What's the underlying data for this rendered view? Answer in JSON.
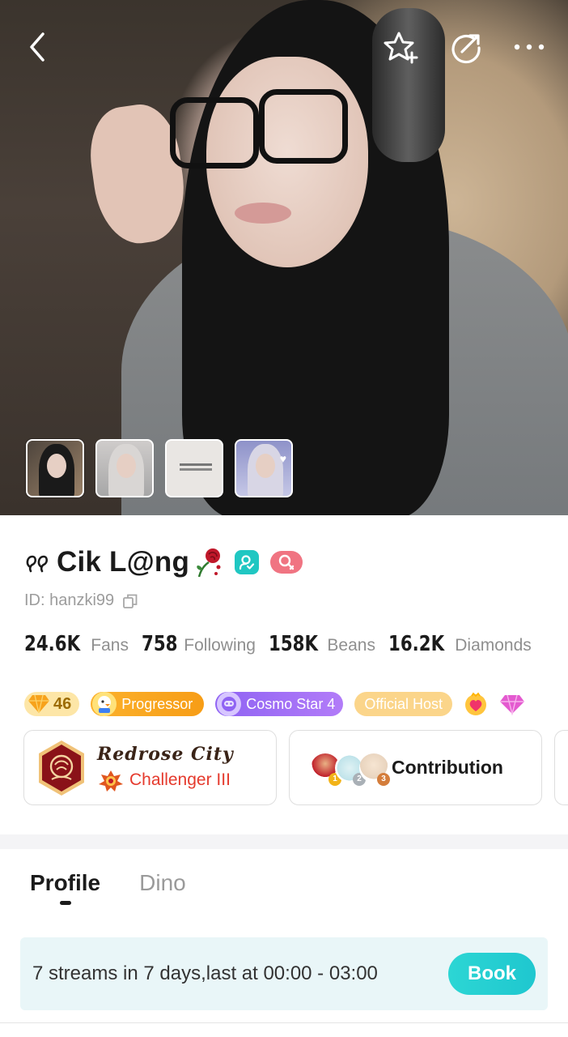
{
  "header": {
    "icons": [
      "back-arrow-icon",
      "star-plus-icon",
      "share-icon",
      "more-icon"
    ]
  },
  "gallery": {
    "thumbnail_count": 4,
    "selected_index": 0
  },
  "profile": {
    "name": "Cik L@ng",
    "id": "ID: hanzki99"
  },
  "stats": [
    {
      "value": "24.6K",
      "label": "Fans"
    },
    {
      "value": "758",
      "label": "Following"
    },
    {
      "value": "158K",
      "label": "Beans"
    },
    {
      "value": "16.2K",
      "label": "Diamonds"
    }
  ],
  "badges": {
    "level": "46",
    "progressor": "Progressor",
    "cosmo": "Cosmo Star 4",
    "host": "Official Host"
  },
  "city_card": {
    "name": "Redrose City",
    "rank": "Challenger III"
  },
  "contribution_card": {
    "label": "Contribution",
    "medals": [
      "1",
      "2",
      "3"
    ]
  },
  "tabs": [
    {
      "label": "Profile",
      "active": true
    },
    {
      "label": "Dino",
      "active": false
    }
  ],
  "schedule": {
    "text": "7 streams in 7 days,last at 00:00 - 03:00",
    "button": "Book"
  },
  "colors": {
    "accent_teal": "#20c7c2",
    "progressor": "#f79d16",
    "cosmo": "#9a6cf5",
    "official_host": "#fbd58a",
    "challenger_red": "#e53a2d"
  }
}
